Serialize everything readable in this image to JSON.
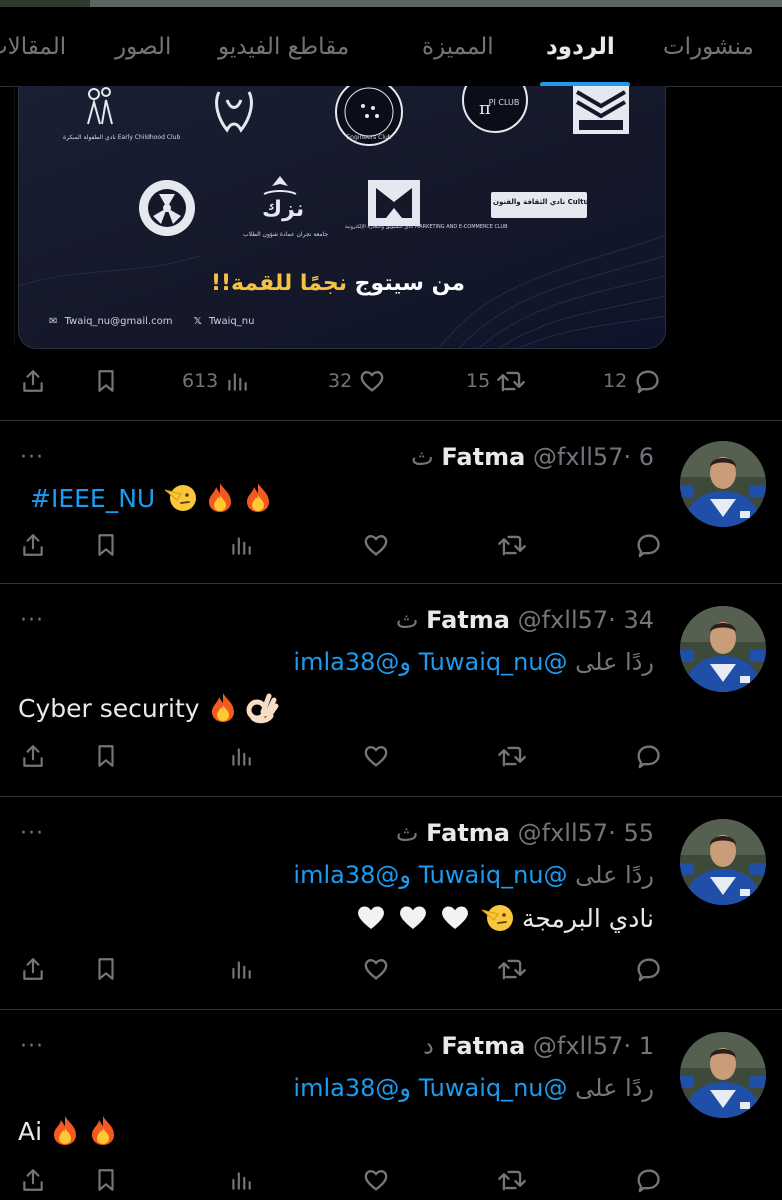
{
  "tabs": {
    "items": [
      {
        "label": "منشورات"
      },
      {
        "label": "الردود"
      },
      {
        "label": "المميزة"
      },
      {
        "label": "مقاطع الفيديو"
      },
      {
        "label": "الصور"
      },
      {
        "label": "المقالات"
      }
    ],
    "active_index": 1
  },
  "post_card": {
    "logos": [
      {
        "caption": "نادي الطفولة المبكرة Early Childhood Club"
      },
      {
        "caption": ""
      },
      {
        "caption": "Engineers Club"
      },
      {
        "caption": "PI CLUB"
      },
      {
        "caption": ""
      },
      {
        "caption": ""
      },
      {
        "caption": "جامعة نجران عمادة شؤون الطلاب"
      },
      {
        "caption": "نادي التسويق والتجارة الإلكترونية MARKETING AND E-COMMERCE CLUB"
      },
      {
        "caption": "نادي الثقافة والفنون Culture and Arts Club N.U"
      }
    ],
    "tagline_prefix": "من سيتوج ",
    "tagline_highlight": "نجمًا للقمة!!",
    "footer_email": "Twaiq_nu@gmail.com",
    "footer_x": "Twaiq_nu",
    "stats": {
      "views": "613",
      "likes": "32",
      "reposts": "15",
      "replies": "12"
    }
  },
  "tweets": [
    {
      "name": "Fatma",
      "handle": "@fxll57",
      "time": "6 ث",
      "reply_to": null,
      "text": "#IEEE_NU",
      "text_is_hashtag": true,
      "emojis": [
        "saluting-face",
        "fire",
        "fire"
      ]
    },
    {
      "name": "Fatma",
      "handle": "@fxll57",
      "time": "34 ث",
      "reply_prefix": "ردًا على",
      "reply_mention_1": "@Tuwaiq_nu",
      "reply_joiner": "و",
      "reply_mention_2": "@imla38",
      "text": "Cyber security",
      "emojis": [
        "fire",
        "ok-hand"
      ]
    },
    {
      "name": "Fatma",
      "handle": "@fxll57",
      "time": "55 ث",
      "reply_prefix": "ردًا على",
      "reply_mention_1": "@Tuwaiq_nu",
      "reply_joiner": "و",
      "reply_mention_2": "@imla38",
      "text": "نادي البرمجة",
      "emojis": [
        "saluting-face",
        "white-heart",
        "white-heart",
        "white-heart"
      ]
    },
    {
      "name": "Fatma",
      "handle": "@fxll57",
      "time": "1 د",
      "reply_prefix": "ردًا على",
      "reply_mention_1": "@Tuwaiq_nu",
      "reply_joiner": "و",
      "reply_mention_2": "@imla38",
      "text": "Ai",
      "emojis": [
        "fire",
        "fire"
      ]
    }
  ],
  "colors": {
    "background": "#000000",
    "text": "#e7e9ea",
    "muted": "#71767b",
    "accent": "#1d9bf0",
    "divider": "#2f3336"
  }
}
